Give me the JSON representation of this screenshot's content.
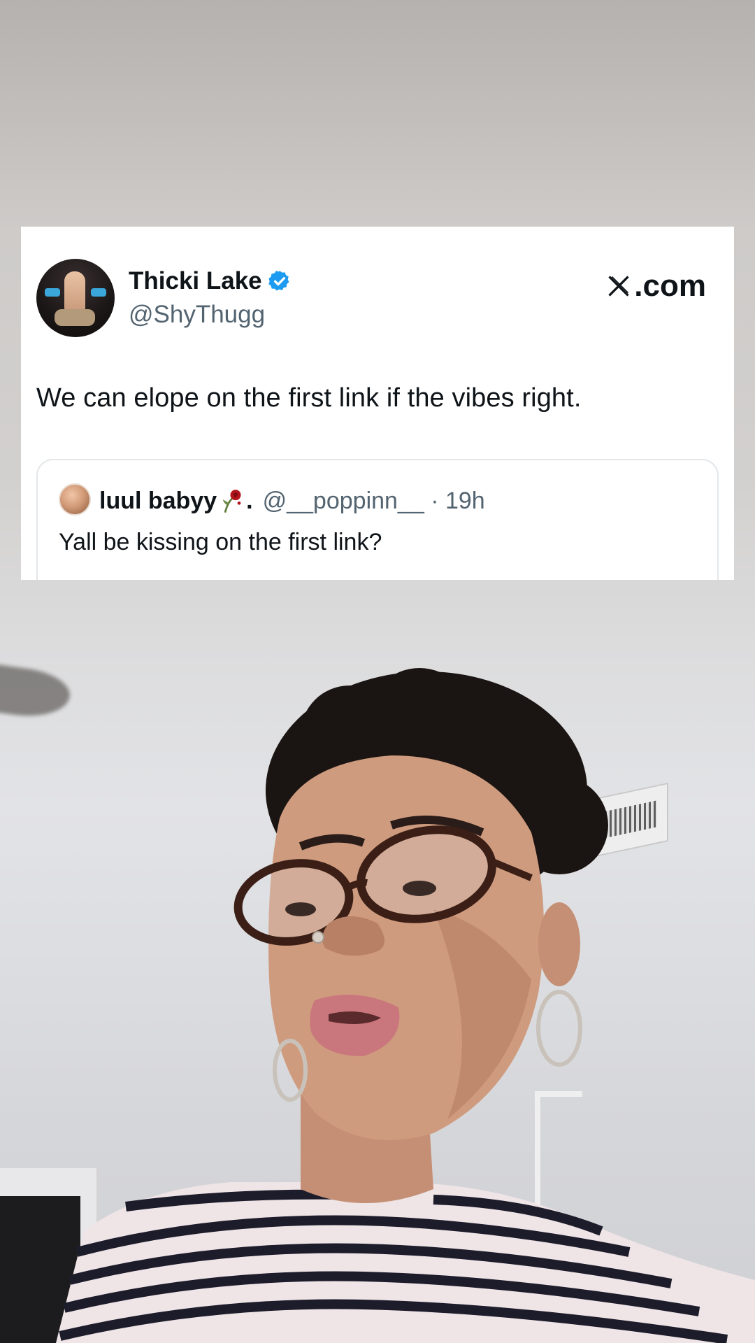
{
  "tweet": {
    "display_name": "Thicki Lake",
    "handle": "@ShyThugg",
    "brand": ".com",
    "text": "We can elope on the first link if the vibes right.",
    "verified_color": "#1d9bf0",
    "quote": {
      "name": "luul babyy",
      "name_suffix": ".",
      "handle": "@__poppinn__",
      "separator": " · ",
      "time": "19h",
      "text": "Yall be kissing on the first link?"
    }
  }
}
